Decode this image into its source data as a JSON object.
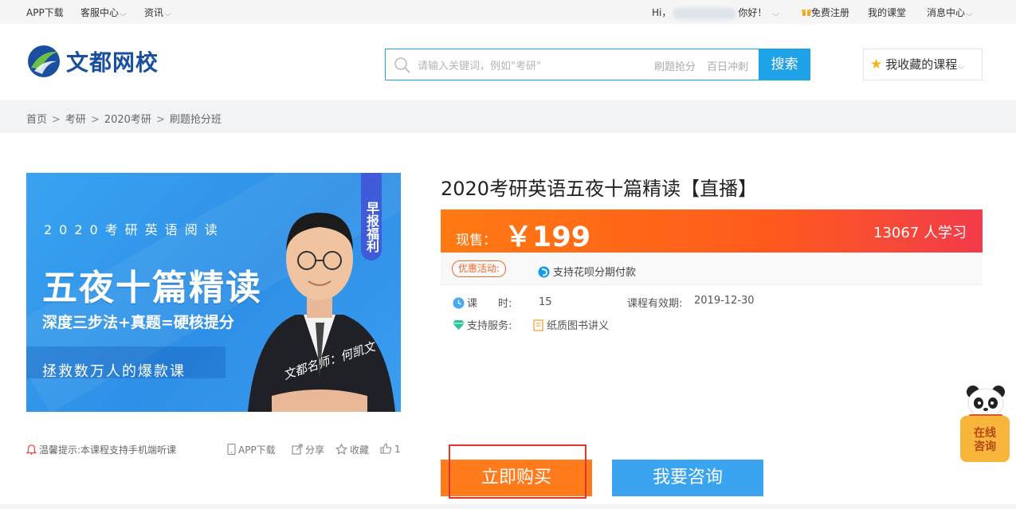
{
  "topbar": {
    "app_download": "APP下载",
    "customer_service": "客服中心",
    "news": "资讯",
    "greeting_prefix": "Hi，",
    "greeting_suffix": "你好！",
    "free_register": "免费注册",
    "my_classroom": "我的课堂",
    "message_center": "消息中心"
  },
  "header": {
    "logo_text": "文都网校",
    "search_placeholder": "请输入关键词，例如\"考研\"",
    "hot_words": [
      "刷题抢分",
      "百日冲刺"
    ],
    "search_button": "搜索",
    "favorites": "我收藏的课程"
  },
  "breadcrumb": [
    "首页",
    "考研",
    "2020考研",
    "刷题抢分班"
  ],
  "banner": {
    "line1": "2020考研英语阅读",
    "title": "五夜十篇精读",
    "subtitle": "深度三步法+真题=硬核提分",
    "bottom": "拯救数万人的爆款课",
    "tag": "早报福利",
    "signature": "文都名师：何凯文"
  },
  "under_banner": {
    "tip": "温馨提示:本课程支持手机端听课",
    "app_download": "APP下载",
    "share": "分享",
    "collect": "收藏",
    "like_count": "1"
  },
  "course": {
    "title": "2020考研英语五夜十篇精读【直播】",
    "price_label": "现售：",
    "price": "￥199",
    "learners": "13067 人学习",
    "promo_tag": "优惠活动:",
    "huabei": "支持花呗分期付款",
    "hours_label": "课　　时:",
    "hours_value": "15",
    "validity_label": "课程有效期:",
    "validity_value": "2019-12-30",
    "service_label": "支持服务:",
    "service_value": "纸质图书讲义",
    "buy_button": "立即购买",
    "consult_button": "我要咨询"
  },
  "online_service": "在线\n咨询",
  "colors": {
    "primary_blue": "#1ea2e8",
    "price_orange": "#ff7a12",
    "buy_orange": "#ff7b1b",
    "consult_blue": "#3aa4f0",
    "highlight_red": "#e8322e"
  }
}
